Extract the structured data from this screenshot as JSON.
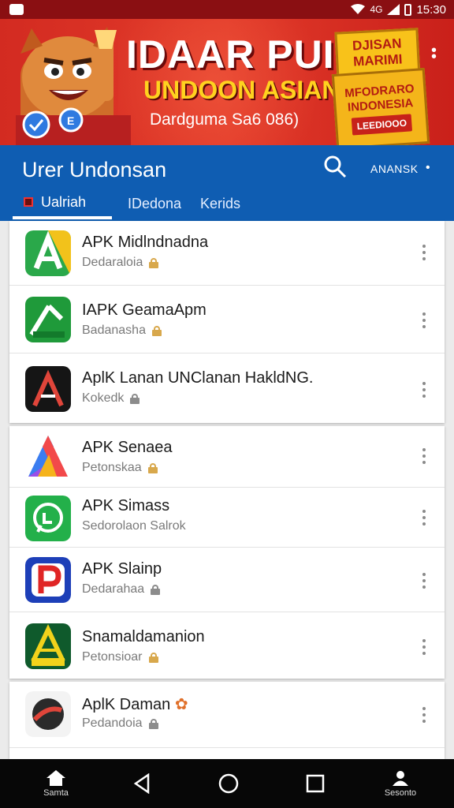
{
  "status_bar": {
    "time": "15:30",
    "carrier": "4G"
  },
  "banner": {
    "title": "IDAAR PUIY",
    "subtitle": "UNDOON ASIAN",
    "tagline": "Dardguma Sa6 086)",
    "promo_1": "DJISAN MARIMI",
    "promo_2": "MFODRARO INDONESIA",
    "promo_2_stamp": "LEEDIOOO"
  },
  "header": {
    "title": "Urer Undonsan",
    "user_label": "ANANSK",
    "tabs": [
      {
        "label": "Ualriah"
      },
      {
        "label": "IDedona"
      },
      {
        "label": "Kerids"
      }
    ]
  },
  "apps": [
    {
      "title": "APK Midlndnadna",
      "subtitle": "Dedaraloia",
      "lock": "gold",
      "icon": "apk-green-yellow-icon"
    },
    {
      "title": "IAPK GeamaApm",
      "subtitle": "Badanasha",
      "lock": "gold",
      "icon": "apk-green-pen-icon"
    },
    {
      "title": "AplK Lanan UNClanan HakldNG.",
      "subtitle": "Kokedk",
      "lock": "gray",
      "icon": "apk-black-red-icon"
    },
    {
      "title": "APK Senaea",
      "subtitle": "Petonskaa",
      "lock": "gold",
      "icon": "apk-gradient-a-icon"
    },
    {
      "title": "APK Simass",
      "subtitle": "Sedorolaon Salrok",
      "lock": "none",
      "icon": "apk-whatsapp-style-icon"
    },
    {
      "title": "APK Slainp",
      "subtitle": "Dedarahaa",
      "lock": "gray",
      "icon": "apk-blue-p-icon"
    },
    {
      "title": "Snamaldamanion",
      "subtitle": "Petonsioar",
      "lock": "gold",
      "icon": "apk-dark-green-icon"
    },
    {
      "title": "AplK Daman",
      "subtitle": "Pedandoia",
      "lock": "gray",
      "icon": "apk-dark-ball-icon"
    }
  ],
  "nav": {
    "home_label": "Samta",
    "profile_label": "Sesonto"
  },
  "colors": {
    "brand_blue": "#0f5db2",
    "banner_red": "#d32b21",
    "accent_yellow": "#ffd21f"
  }
}
